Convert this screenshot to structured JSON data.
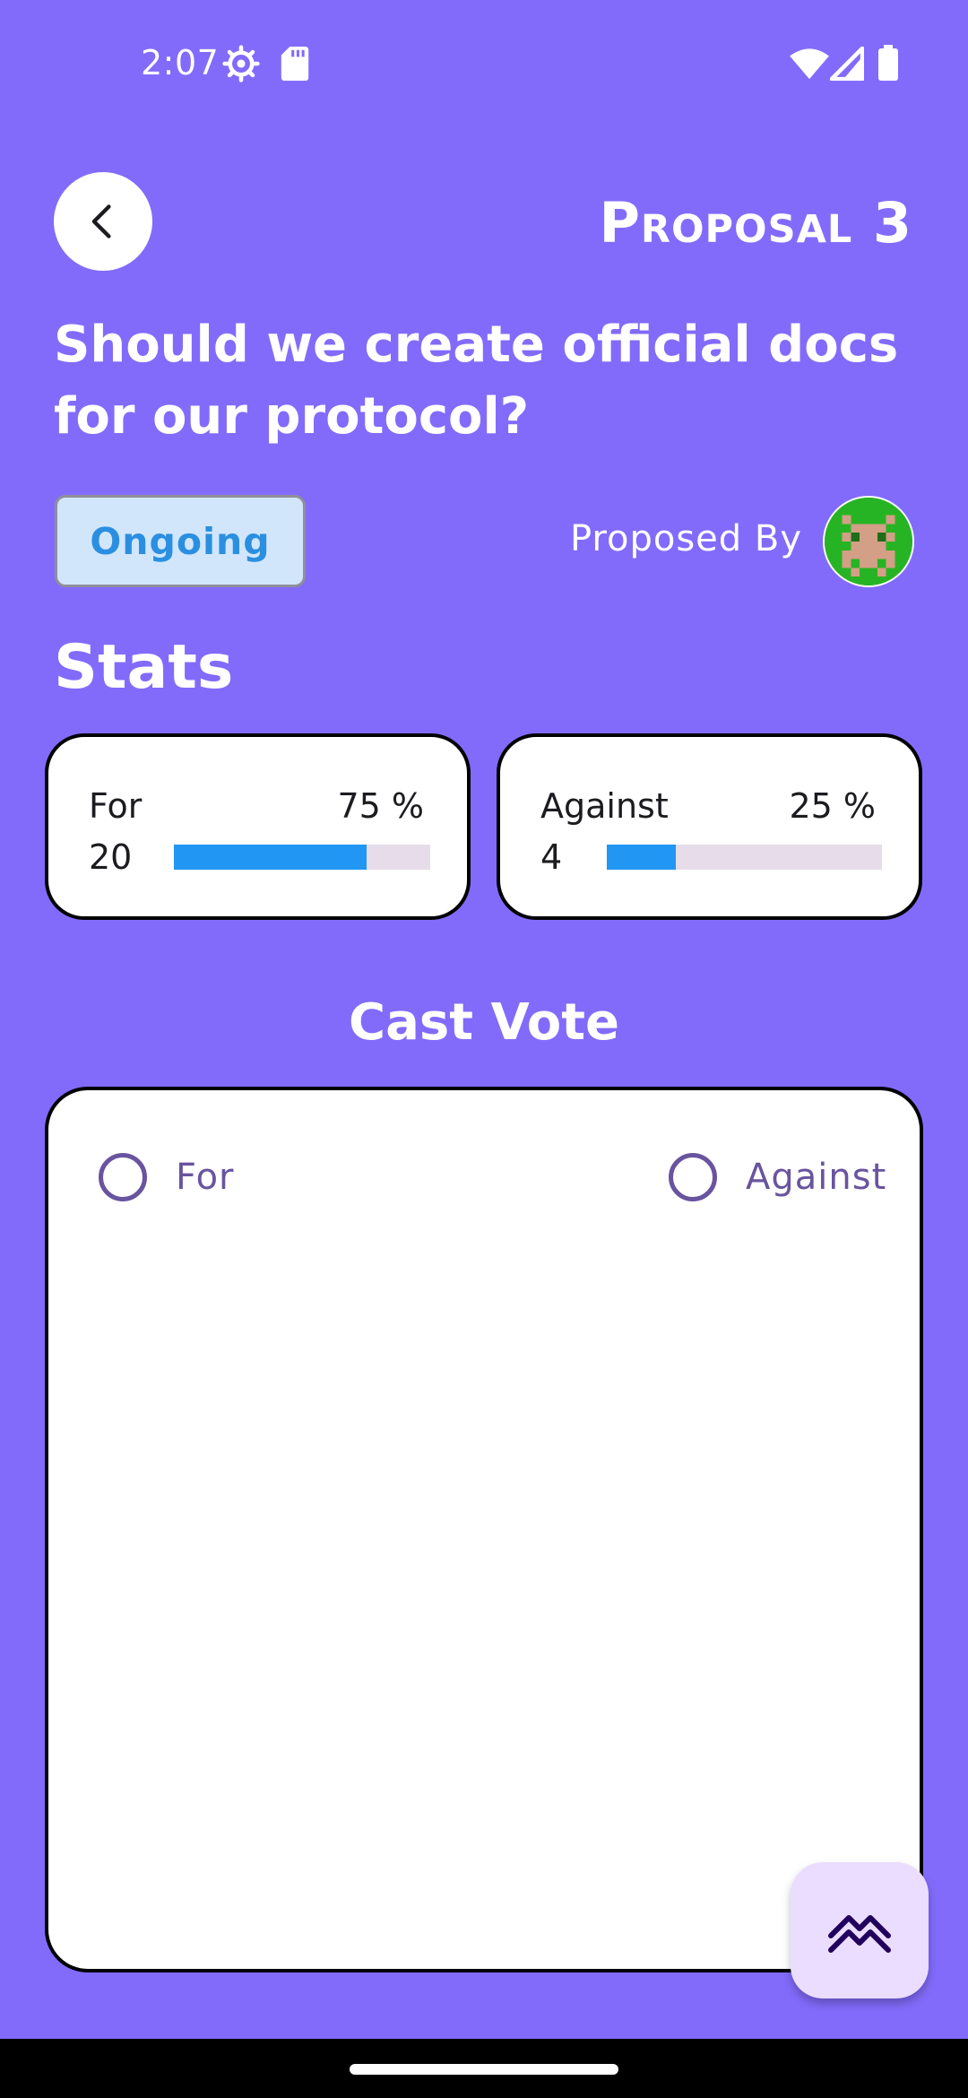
{
  "status_bar": {
    "time": "2:07",
    "icons": [
      "gear-icon",
      "sd-card-icon",
      "wifi-icon",
      "signal-icon",
      "battery-icon"
    ]
  },
  "header": {
    "back_icon": "chevron-left-icon",
    "title": "Proposal 3"
  },
  "proposal": {
    "question": "Should we create official docs for our protocol?",
    "status": "Ongoing",
    "proposed_by_label": "Proposed By",
    "avatar_icon": "pixel-avatar-icon"
  },
  "stats": {
    "title": "Stats",
    "for": {
      "label": "For",
      "count": "20",
      "percent_text": "75 %",
      "fraction": 0.75
    },
    "against": {
      "label": "Against",
      "count": "4",
      "percent_text": "25 %",
      "fraction": 0.25
    }
  },
  "vote": {
    "title": "Cast Vote",
    "options": [
      {
        "label": "For",
        "selected": false
      },
      {
        "label": "Against",
        "selected": false
      }
    ]
  },
  "fab": {
    "icon": "stats-trend-icon"
  },
  "colors": {
    "background": "#826bfb",
    "bar_fill": "#2196f3",
    "bar_track": "#e6dcea",
    "chip_bg": "#d2e6fb",
    "chip_text": "#2a8fe0",
    "radio": "#68549f",
    "fab_bg": "#eaddff",
    "avatar_bg": "#27b424"
  }
}
